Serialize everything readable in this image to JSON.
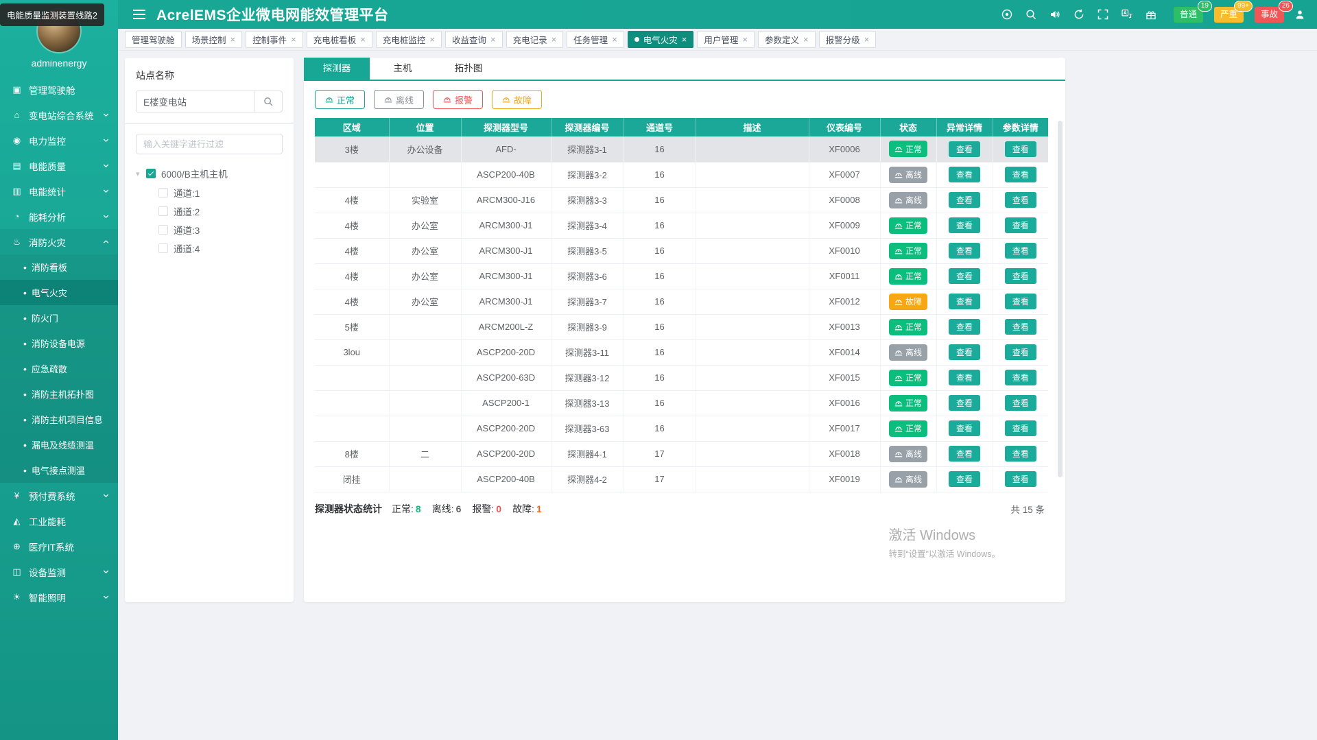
{
  "tooltip": {
    "text": "电能质量监测装置线路2"
  },
  "header": {
    "title": "AcrelEMS企业微电网能效管理平台",
    "icons": [
      {
        "name": "support-icon"
      },
      {
        "name": "search-icon"
      },
      {
        "name": "volume-icon"
      },
      {
        "name": "refresh-icon"
      },
      {
        "name": "fullscreen-icon"
      },
      {
        "name": "translate-icon"
      },
      {
        "name": "gift-icon"
      }
    ],
    "alarm_badges": [
      {
        "id": "normal",
        "label": "普通",
        "count": "19",
        "color": "#2fbe68"
      },
      {
        "id": "severe",
        "label": "严重",
        "count": "99+",
        "color": "#f6bc2b"
      },
      {
        "id": "accident",
        "label": "事故",
        "count": "26",
        "color": "#f15555"
      }
    ]
  },
  "sidebar": {
    "username": "adminenergy",
    "items": [
      {
        "id": "dashboard",
        "label": "管理驾驶舱",
        "icon": "dashboard-icon",
        "expandable": false
      },
      {
        "id": "substation",
        "label": "变电站综合系统",
        "icon": "substation-icon",
        "expandable": true
      },
      {
        "id": "power-monitor",
        "label": "电力监控",
        "icon": "power-monitor-icon",
        "expandable": true
      },
      {
        "id": "power-quality",
        "label": "电能质量",
        "icon": "power-quality-icon",
        "expandable": true
      },
      {
        "id": "power-stats",
        "label": "电能统计",
        "icon": "power-stats-icon",
        "expandable": true
      },
      {
        "id": "energy-analysis",
        "label": "能耗分析",
        "icon": "energy-analysis-icon",
        "expandable": true
      },
      {
        "id": "fire",
        "label": "消防火灾",
        "icon": "fire-icon",
        "expandable": true,
        "expanded": true,
        "children": [
          {
            "id": "fire-board",
            "label": "消防看板",
            "active": false
          },
          {
            "id": "electric-fire",
            "label": "电气火灾",
            "active": true
          },
          {
            "id": "fire-door",
            "label": "防火门",
            "active": false
          },
          {
            "id": "fire-equipment-power",
            "label": "消防设备电源",
            "active": false
          },
          {
            "id": "evacuation",
            "label": "应急疏散",
            "active": false
          },
          {
            "id": "fire-host-topology",
            "label": "消防主机拓扑图",
            "active": false
          },
          {
            "id": "fire-host-project-info",
            "label": "消防主机项目信息",
            "active": false
          },
          {
            "id": "leakage-cable-temp",
            "label": "漏电及线缆测温",
            "active": false
          },
          {
            "id": "electric-contact-temp",
            "label": "电气接点测温",
            "active": false
          }
        ]
      },
      {
        "id": "prepaid",
        "label": "预付费系统",
        "icon": "prepaid-icon",
        "expandable": true
      },
      {
        "id": "industry-energy",
        "label": "工业能耗",
        "icon": "industry-icon",
        "expandable": false
      },
      {
        "id": "medical-it",
        "label": "医疗IT系统",
        "icon": "medical-icon",
        "expandable": false
      },
      {
        "id": "device-monitor",
        "label": "设备监测",
        "icon": "device-icon",
        "expandable": true
      },
      {
        "id": "smart-lighting",
        "label": "智能照明",
        "icon": "lighting-icon",
        "expandable": true
      }
    ]
  },
  "tabbar": [
    {
      "id": "dashboard",
      "label": "管理驾驶舱",
      "closable": false,
      "active": false
    },
    {
      "id": "scene-control",
      "label": "场景控制",
      "closable": true,
      "active": false
    },
    {
      "id": "control-events",
      "label": "控制事件",
      "closable": true,
      "active": false
    },
    {
      "id": "charger-board",
      "label": "充电桩看板",
      "closable": true,
      "active": false
    },
    {
      "id": "charger-monitor",
      "label": "充电桩监控",
      "closable": true,
      "active": false
    },
    {
      "id": "revenue-query",
      "label": "收益查询",
      "closable": true,
      "active": false
    },
    {
      "id": "charge-records",
      "label": "充电记录",
      "closable": true,
      "active": false
    },
    {
      "id": "task-management",
      "label": "任务管理",
      "closable": true,
      "active": false
    },
    {
      "id": "electric-fire",
      "label": "电气火灾",
      "closable": true,
      "active": true
    },
    {
      "id": "user-management",
      "label": "用户管理",
      "closable": true,
      "active": false
    },
    {
      "id": "param-definition",
      "label": "参数定义",
      "closable": true,
      "active": false
    },
    {
      "id": "alarm-grading",
      "label": "报警分级",
      "closable": true,
      "active": false
    }
  ],
  "site_panel": {
    "title": "站点名称",
    "search_value": "E楼变电站",
    "filter_placeholder": "输入关键字进行过滤",
    "tree": {
      "root": "6000/B主机主机",
      "children": [
        "通道:1",
        "通道:2",
        "通道:3",
        "通道:4"
      ]
    }
  },
  "content": {
    "tabs": [
      {
        "id": "detector",
        "label": "探测器"
      },
      {
        "id": "host",
        "label": "主机"
      },
      {
        "id": "topology",
        "label": "拓扑图"
      }
    ],
    "active_tab": "detector",
    "filters": [
      {
        "id": "normal",
        "label": "正常",
        "color": "#18a795"
      },
      {
        "id": "offline",
        "label": "离线",
        "color": "#8a9199"
      },
      {
        "id": "alarm",
        "label": "报警",
        "color": "#f15555"
      },
      {
        "id": "fault",
        "label": "故障",
        "color": "#f5a71b"
      }
    ],
    "table": {
      "headers": [
        "区域",
        "位置",
        "探测器型号",
        "探测器编号",
        "通道号",
        "描述",
        "仪表编号",
        "状态",
        "异常详情",
        "参数详情"
      ],
      "view_label": "查看",
      "rows": [
        {
          "cells": [
            "3楼",
            "办公设备",
            "AFD-",
            "探测器3-1",
            "16",
            "",
            "XF0006"
          ],
          "status": "正常",
          "status_type": "normal"
        },
        {
          "cells": [
            "",
            "",
            "ASCP200-40B",
            "探测器3-2",
            "16",
            "",
            "XF0007"
          ],
          "status": "离线",
          "status_type": "offline"
        },
        {
          "cells": [
            "4楼",
            "实验室",
            "ARCM300-J16",
            "探测器3-3",
            "16",
            "",
            "XF0008"
          ],
          "status": "离线",
          "status_type": "offline"
        },
        {
          "cells": [
            "4楼",
            "办公室",
            "ARCM300-J1",
            "探测器3-4",
            "16",
            "",
            "XF0009"
          ],
          "status": "正常",
          "status_type": "normal"
        },
        {
          "cells": [
            "4楼",
            "办公室",
            "ARCM300-J1",
            "探测器3-5",
            "16",
            "",
            "XF0010"
          ],
          "status": "正常",
          "status_type": "normal"
        },
        {
          "cells": [
            "4楼",
            "办公室",
            "ARCM300-J1",
            "探测器3-6",
            "16",
            "",
            "XF0011"
          ],
          "status": "正常",
          "status_type": "normal"
        },
        {
          "cells": [
            "4楼",
            "办公室",
            "ARCM300-J1",
            "探测器3-7",
            "16",
            "",
            "XF0012"
          ],
          "status": "故障",
          "status_type": "fault"
        },
        {
          "cells": [
            "5楼",
            "",
            "ARCM200L-Z",
            "探测器3-9",
            "16",
            "",
            "XF0013"
          ],
          "status": "正常",
          "status_type": "normal"
        },
        {
          "cells": [
            "3lou",
            "",
            "ASCP200-20D",
            "探测器3-11",
            "16",
            "",
            "XF0014"
          ],
          "status": "离线",
          "status_type": "offline"
        },
        {
          "cells": [
            "",
            "",
            "ASCP200-63D",
            "探测器3-12",
            "16",
            "",
            "XF0015"
          ],
          "status": "正常",
          "status_type": "normal"
        },
        {
          "cells": [
            "",
            "",
            "ASCP200-1",
            "探测器3-13",
            "16",
            "",
            "XF0016"
          ],
          "status": "正常",
          "status_type": "normal"
        },
        {
          "cells": [
            "",
            "",
            "ASCP200-20D",
            "探测器3-63",
            "16",
            "",
            "XF0017"
          ],
          "status": "正常",
          "status_type": "normal"
        },
        {
          "cells": [
            "8楼",
            "二",
            "ASCP200-20D",
            "探测器4-1",
            "17",
            "",
            "XF0018"
          ],
          "status": "离线",
          "status_type": "offline"
        },
        {
          "cells": [
            "闭挂",
            "",
            "ASCP200-40B",
            "探测器4-2",
            "17",
            "",
            "XF0019"
          ],
          "status": "离线",
          "status_type": "offline"
        }
      ]
    },
    "summary": {
      "label": "探测器状态统计",
      "stats": [
        {
          "id": "normal",
          "label": "正常:",
          "value": "8",
          "color": "#0cbe7e"
        },
        {
          "id": "offline",
          "label": "离线:",
          "value": "6",
          "color": "#606266"
        },
        {
          "id": "alarm",
          "label": "报警:",
          "value": "0",
          "color": "#f15555"
        },
        {
          "id": "fault",
          "label": "故障:",
          "value": "1",
          "color": "#f0641e"
        }
      ],
      "total": "共 15 条"
    }
  },
  "watermark": {
    "line1": "激活 Windows",
    "line2": "转到“设置”以激活 Windows。"
  }
}
